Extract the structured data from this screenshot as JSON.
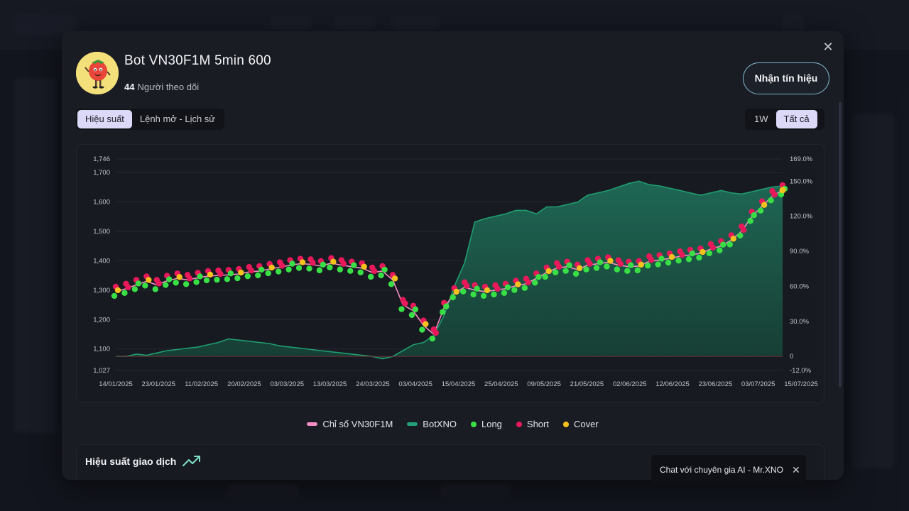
{
  "modal": {
    "bot_name": "Bot VN30F1M 5min 600",
    "followers_count": "44",
    "followers_label": "Người theo dõi",
    "signal_button": "Nhận tín hiệu",
    "close_icon": "close-icon",
    "tabs": [
      {
        "label": "Hiệu suất",
        "active": true
      },
      {
        "label": "Lệnh mở - Lịch sử",
        "active": false
      }
    ],
    "range_tabs": [
      {
        "label": "1W",
        "active": false
      },
      {
        "label": "Tất cả",
        "active": true
      }
    ],
    "performance_title": "Hiệu suất giao dịch",
    "performance_icon": "trending-up-icon"
  },
  "chat": {
    "label": "Chat với chuyên gia AI - Mr.XNO",
    "close_icon": "close-icon"
  },
  "colors": {
    "accent": "#dcd9f8",
    "index_line": "#f58fc4",
    "bot_line": "#1f9e6e",
    "bot_fill": "#1a5b4c",
    "long": "#38e045",
    "short": "#e8195a",
    "cover": "#f5c21d"
  },
  "chart_data": {
    "type": "line",
    "title": "",
    "x_tick_labels": [
      "14/01/2025",
      "23/01/2025",
      "11/02/2025",
      "20/02/2025",
      "03/03/2025",
      "13/03/2025",
      "24/03/2025",
      "03/04/2025",
      "15/04/2025",
      "25/04/2025",
      "09/05/2025",
      "21/05/2025",
      "02/06/2025",
      "12/06/2025",
      "23/06/2025",
      "03/07/2025",
      "15/07/2025"
    ],
    "y_left_ticks": [
      "1,027",
      "1,100",
      "1,200",
      "1,300",
      "1,400",
      "1,500",
      "1,600",
      "1,700",
      "1,746"
    ],
    "y_left_values": [
      1027,
      1100,
      1200,
      1300,
      1400,
      1500,
      1600,
      1700,
      1746
    ],
    "y_left_range": [
      1027,
      1746
    ],
    "y_right_ticks": [
      "-12.0%",
      "0",
      "30.0%",
      "60.0%",
      "90.0%",
      "120.0%",
      "150.0%",
      "169.0%"
    ],
    "y_right_values": [
      -12,
      0,
      30,
      60,
      90,
      120,
      150,
      169
    ],
    "y_right_range": [
      -12,
      169
    ],
    "grid": true,
    "legend_position": "bottom",
    "series": [
      {
        "name": "Chỉ số VN30F1M",
        "axis": "left",
        "values": [
          1295,
          1305,
          1318,
          1330,
          1318,
          1332,
          1340,
          1335,
          1342,
          1348,
          1350,
          1352,
          1355,
          1362,
          1365,
          1372,
          1378,
          1385,
          1390,
          1388,
          1382,
          1392,
          1385,
          1380,
          1375,
          1360,
          1365,
          1335,
          1250,
          1230,
          1180,
          1150,
          1240,
          1290,
          1310,
          1300,
          1295,
          1300,
          1305,
          1315,
          1322,
          1340,
          1360,
          1375,
          1380,
          1370,
          1385,
          1390,
          1395,
          1385,
          1380,
          1382,
          1398,
          1402,
          1408,
          1415,
          1420,
          1425,
          1440,
          1450,
          1470,
          1500,
          1550,
          1585,
          1620,
          1640
        ]
      },
      {
        "name": "BotXNO",
        "axis": "right",
        "values": [
          0,
          0,
          2,
          1,
          3,
          5,
          6,
          7,
          8,
          10,
          12,
          15,
          14,
          13,
          12,
          11,
          9,
          8,
          7,
          6,
          5,
          4,
          3,
          2,
          1,
          0,
          -2,
          0,
          5,
          10,
          12,
          18,
          35,
          60,
          80,
          115,
          118,
          120,
          122,
          125,
          125,
          122,
          128,
          128,
          130,
          132,
          138,
          140,
          142,
          145,
          148,
          150,
          147,
          146,
          144,
          142,
          140,
          138,
          140,
          142,
          140,
          139,
          141,
          143,
          145,
          146
        ]
      }
    ],
    "markers": [
      "Long",
      "Short",
      "Cover"
    ]
  }
}
